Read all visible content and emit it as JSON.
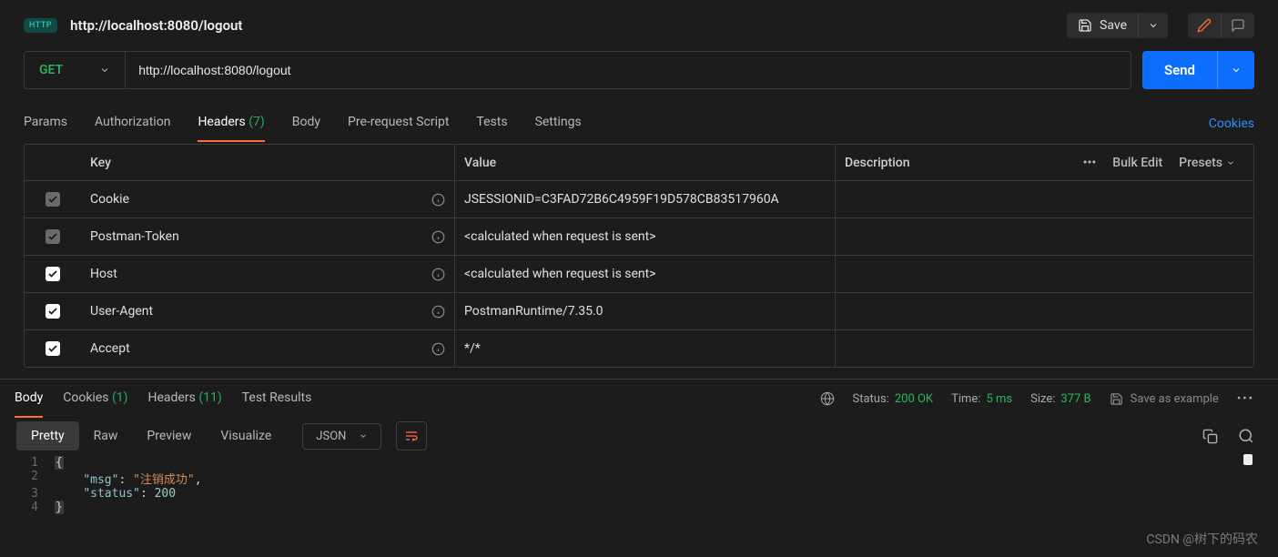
{
  "header": {
    "badge": "HTTP",
    "title": "http://localhost:8080/logout",
    "save_label": "Save"
  },
  "request": {
    "method": "GET",
    "url": "http://localhost:8080/logout",
    "send_label": "Send"
  },
  "req_tabs": {
    "params": "Params",
    "auth": "Authorization",
    "headers_label": "Headers",
    "headers_count": "(7)",
    "body": "Body",
    "prerequest": "Pre-request Script",
    "tests": "Tests",
    "settings": "Settings",
    "cookies_link": "Cookies"
  },
  "headers_table": {
    "col_key": "Key",
    "col_value": "Value",
    "col_desc": "Description",
    "bulk_edit": "Bulk Edit",
    "presets": "Presets",
    "rows": [
      {
        "checked": true,
        "locked": true,
        "key": "Cookie",
        "value": "JSESSIONID=C3FAD72B6C4959F19D578CB83517960A"
      },
      {
        "checked": true,
        "locked": true,
        "key": "Postman-Token",
        "value": "<calculated when request is sent>"
      },
      {
        "checked": true,
        "locked": false,
        "key": "Host",
        "value": "<calculated when request is sent>"
      },
      {
        "checked": true,
        "locked": false,
        "key": "User-Agent",
        "value": "PostmanRuntime/7.35.0"
      },
      {
        "checked": true,
        "locked": false,
        "key": "Accept",
        "value": "*/*"
      }
    ]
  },
  "resp_tabs": {
    "body": "Body",
    "cookies_label": "Cookies",
    "cookies_count": "(1)",
    "headers_label": "Headers",
    "headers_count": "(11)",
    "test_results": "Test Results"
  },
  "resp_meta": {
    "status_label": "Status:",
    "status_value": "200 OK",
    "time_label": "Time:",
    "time_value": "5 ms",
    "size_label": "Size:",
    "size_value": "377 B",
    "save_example": "Save as example"
  },
  "view": {
    "pretty": "Pretty",
    "raw": "Raw",
    "preview": "Preview",
    "visualize": "Visualize",
    "format": "JSON"
  },
  "code": {
    "line_numbers": [
      "1",
      "2",
      "3",
      "4"
    ],
    "l1_brace": "{",
    "l2_key": "\"msg\"",
    "l2_sep": ": ",
    "l2_val": "\"注销成功\"",
    "l2_comma": ",",
    "l3_key": "\"status\"",
    "l3_sep": ": ",
    "l3_val": "200",
    "l4_brace": "}"
  },
  "watermark": "CSDN @树下的码农"
}
